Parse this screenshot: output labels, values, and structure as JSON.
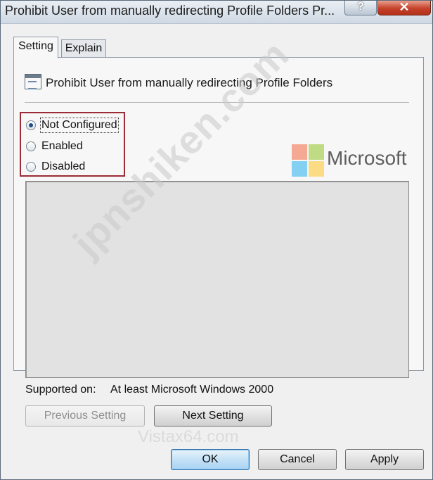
{
  "window": {
    "title": "Prohibit User from manually redirecting Profile Folders Pr...",
    "help_label": "?",
    "close_label": "✕"
  },
  "tabs": [
    {
      "label": "Setting",
      "selected": true
    },
    {
      "label": "Explain",
      "selected": false
    }
  ],
  "policy": {
    "icon": "policy-setting-icon",
    "name": "Prohibit User from manually redirecting Profile Folders"
  },
  "options": [
    {
      "label": "Not Configured",
      "checked": true
    },
    {
      "label": "Enabled",
      "checked": false
    },
    {
      "label": "Disabled",
      "checked": false
    }
  ],
  "supported": {
    "label": "Supported on:",
    "value": "At least Microsoft Windows 2000"
  },
  "buttons": {
    "previous": "Previous Setting",
    "next": "Next Setting",
    "ok": "OK",
    "cancel": "Cancel",
    "apply": "Apply"
  },
  "overlay": {
    "brand": "Microsoft",
    "watermark": "jpnshiken.com",
    "watermark2": "Vistax64.com"
  },
  "colors": {
    "highlight_box": "#9b2b36",
    "ms_red": "#f25022",
    "ms_green": "#7fba00",
    "ms_blue": "#00a4ef",
    "ms_yellow": "#ffb900"
  }
}
